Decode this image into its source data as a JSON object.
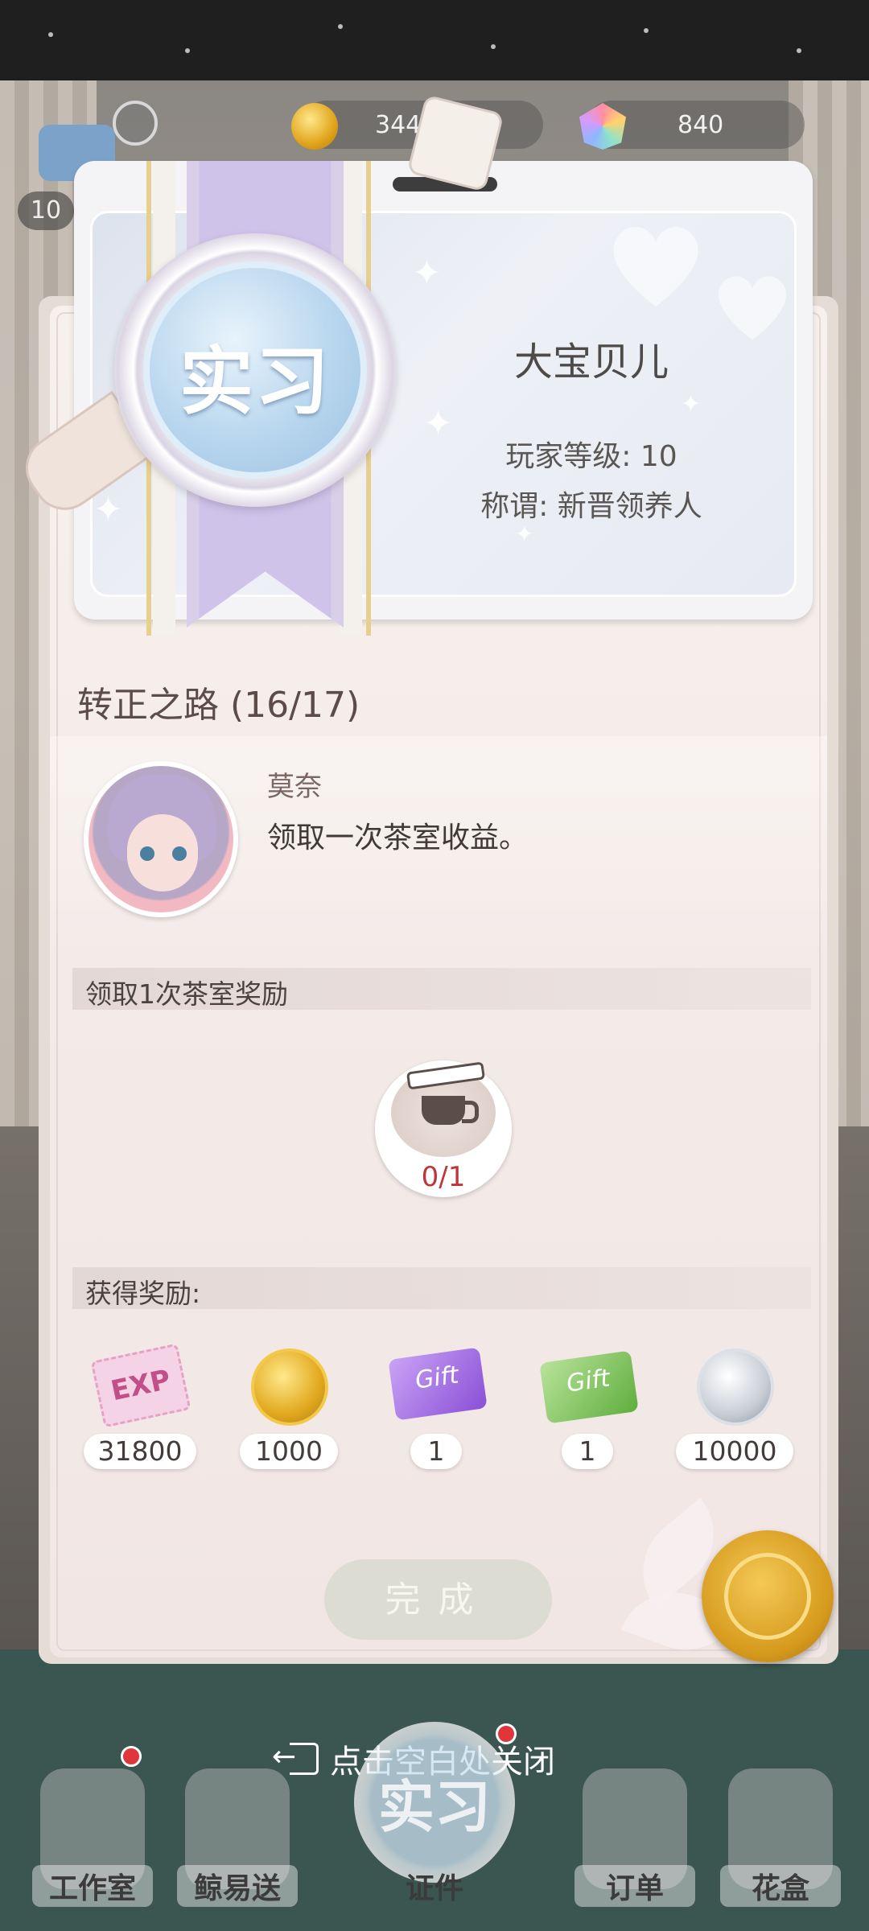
{
  "resources": {
    "level": "10",
    "coins": "344",
    "gems": "840"
  },
  "badge": {
    "rank": "实习",
    "player_name": "大宝贝儿",
    "player_level": "玩家等级: 10",
    "player_title": "称谓: 新晋领养人"
  },
  "progress": {
    "title": "转正之路 (16/17)",
    "npc_name": "莫奈",
    "npc_text": "领取一次茶室收益。",
    "task_label": "领取1次茶室奖励",
    "task_progress": "0/1"
  },
  "rewards": {
    "label": "获得奖励:",
    "items": [
      {
        "icon": "exp-ticket-icon",
        "text": "EXP",
        "amount": "31800"
      },
      {
        "icon": "gold-coin-icon",
        "amount": "1000"
      },
      {
        "icon": "purple-gift-card-icon",
        "text": "Gift",
        "amount": "1"
      },
      {
        "icon": "green-gift-card-icon",
        "text": "Gift",
        "amount": "1"
      },
      {
        "icon": "silver-coin-icon",
        "amount": "10000"
      }
    ]
  },
  "actions": {
    "done_label": "完成",
    "close_hint": "点击空白处关闭"
  },
  "nav": {
    "items": [
      {
        "label": "工作室",
        "badge": true
      },
      {
        "label": "鲸易送",
        "badge": false
      },
      {
        "label": "证件",
        "center": "实习",
        "badge": true
      },
      {
        "label": "订单",
        "badge": false
      },
      {
        "label": "花盒",
        "badge": false
      }
    ]
  },
  "colors": {
    "card_bg": "#f4ece9",
    "progress_red": "#c0353c",
    "done_button": "#dcdcd2",
    "ribbon": "#cfc3ea",
    "medal": "#b8d6ee",
    "seal_gold": "#d69a1d"
  }
}
